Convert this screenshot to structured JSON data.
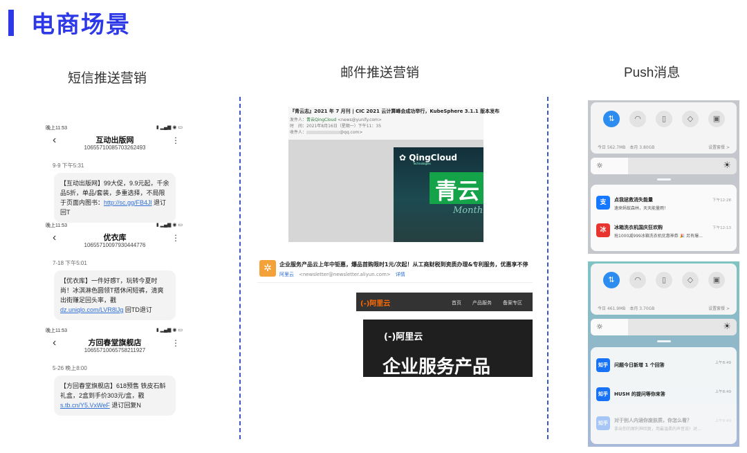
{
  "page": {
    "title": "电商场景",
    "accent": "#2d39e6"
  },
  "columns": [
    {
      "title": "短信推送营销"
    },
    {
      "title": "邮件推送营销"
    },
    {
      "title": "Push消息"
    }
  ],
  "sms": [
    {
      "status_time": "晚上11:53",
      "contact": "互动出版网",
      "number": "10655710085703262493",
      "time": "9-9 下午5:31",
      "text": "【互动出版网】99大促，9.9元起，千余品5折，单品/套装，多重选择，不局限于页面内图书：",
      "link": "http://sc.gg/FB4Jl",
      "suffix": " 退订回T"
    },
    {
      "status_time": "晚上11:53",
      "contact": "优衣库",
      "number": "10655710097930444776",
      "time": "7-18 下午5:01",
      "text": "【优衣库】一件好感T，玩转今夏时尚！冰淇淋色圆领T搭休闲短裤，清爽出街赚足回头率，戳 ",
      "link": "dz.uniqlo.com/LVR8lJg",
      "suffix": " 回TD退订"
    },
    {
      "status_time": "晚上11:53",
      "contact": "方回春堂旗舰店",
      "number": "10655710065758211927",
      "time": "5-26 晚上8:00",
      "text": "【方回春堂旗舰店】618预售 铁皮石斛礼盒，2盒到手价303元/盒，戳 ",
      "link": "s.tb.cn/Y5.VxWeF",
      "suffix": " 退订回复N"
    }
  ],
  "email": {
    "qingcloud": {
      "subject": "『青云志』2021 年 7 月刊 | CIC 2021 云计算峰会成功举行，KubeSphere 3.1.1 版本发布",
      "sender_label": "发件人：",
      "sender": "青云QingCloud",
      "sender_addr": "<news@yunify.com>",
      "date_label": "时　间：",
      "date": "2021年8月16日（星期一）下午11：35",
      "to_label": "收件人：",
      "to": "@qq.com>",
      "brand": "QingCloud",
      "brand_sub": "Technologies",
      "hero": "青云",
      "hero_sub": "Monthly"
    },
    "aliyun": {
      "subject": "企业服务产品云上年中钜惠，爆品首购限时1元/次起！从工商财税到资质办理&专利服务，优惠享不停",
      "sender": "阿里云",
      "sender_addr": "<newsletter@newsletter.aliyun.com>",
      "detail": "详情",
      "logo": "(-)阿里云",
      "menu": [
        "首页",
        "产品服务",
        "备案专区"
      ],
      "hero_logo": "(-)阿里云",
      "hero_title": "企业服务产品"
    }
  },
  "push": [
    {
      "data_usage": "今日 562.7MB　本月 3.80GB",
      "settings": "设置套餐 >",
      "notifications": [
        {
          "app_icon": "alipay-icon",
          "icon_text": "支",
          "color": "#1677ff",
          "title": "点我拯救消失能量",
          "body": "速来蚂蚁森林，天天能量雨！",
          "time": "下午12:28"
        },
        {
          "app_icon": "haier-icon",
          "icon_text": "冰",
          "color": "#e8352f",
          "title": "冰箱洗衣机国庆狂欢购",
          "body": "抢1000减999冰箱洗衣机优惠神券 🎉 另有爆…",
          "time": "下午12:13"
        }
      ]
    },
    {
      "data_usage": "今日 461.9MB　本月 3.70GB",
      "settings": "设置套餐 >",
      "notifications": [
        {
          "app_icon": "zhihu-icon",
          "icon_text": "知乎",
          "color": "#1772f6",
          "title": "问题今日新增 1 个回答",
          "body": "",
          "time": "上午8:49"
        },
        {
          "app_icon": "zhihu-icon",
          "icon_text": "知乎",
          "color": "#1772f6",
          "title": "HUSH 的提问等你来答",
          "body": "",
          "time": "上午8:49"
        },
        {
          "app_icon": "zhihu-icon",
          "icon_text": "知乎",
          "color": "#1772f6",
          "title": "对于别人内涵你废肤质，你怎么看？",
          "body": "拿出你的犀利神回复，用最温柔的声音说！对…",
          "time": "上午8:49"
        }
      ]
    }
  ]
}
